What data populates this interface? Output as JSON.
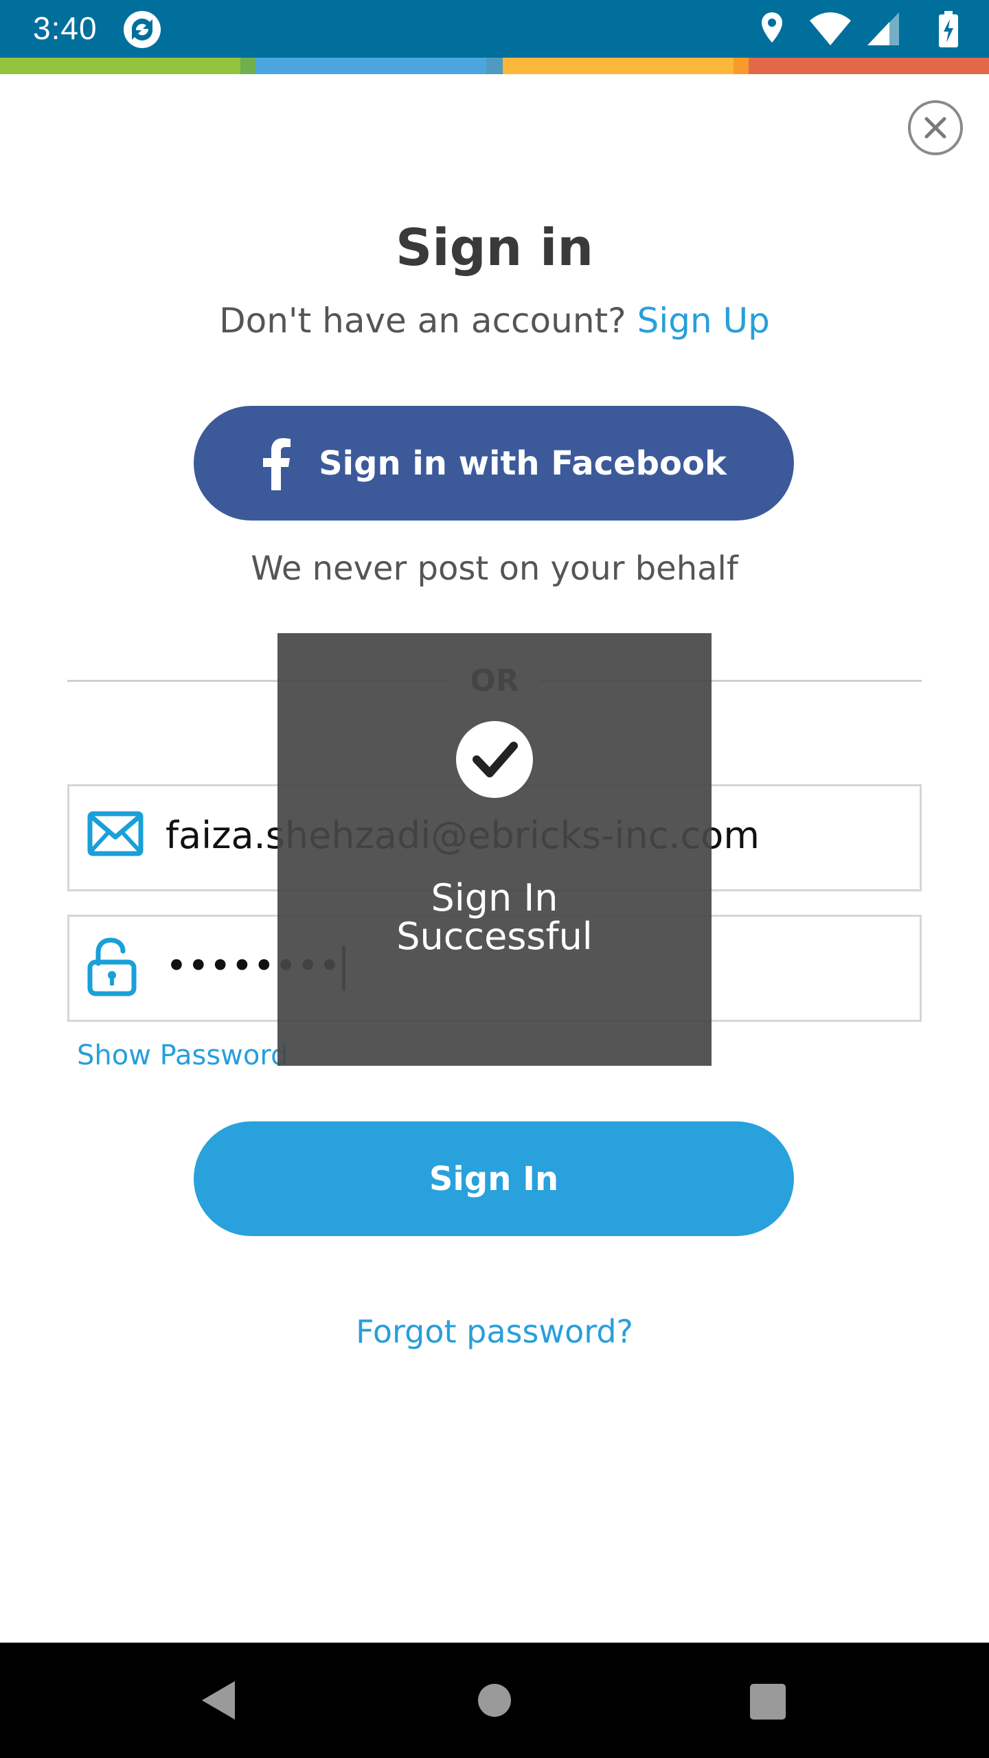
{
  "status_bar": {
    "time": "3:40",
    "icons": [
      "app-sync-icon",
      "location-icon",
      "wifi-icon",
      "cell-signal-icon",
      "battery-charging-icon"
    ]
  },
  "colors": {
    "status_bar": "#006f9c",
    "stripe": [
      "#94c33d",
      "#4ba6df",
      "#fdb73b",
      "#e36846"
    ],
    "facebook": "#3c5a9a",
    "primary": "#28a1dc",
    "link": "#279fda"
  },
  "header": {
    "title": "Sign in",
    "no_account_text": "Don't have an account?",
    "signup_link": "Sign Up"
  },
  "facebook": {
    "button_label": "Sign in with Facebook",
    "note": "We never post on your behalf"
  },
  "divider": {
    "label": "OR"
  },
  "form": {
    "email_value": "faiza.shehzadi@ebricks-inc.com",
    "password_masked": "••••••••",
    "show_password_label": "Show Password",
    "submit_label": "Sign In",
    "forgot_label": "Forgot password?"
  },
  "toast": {
    "line1": "Sign In",
    "line2": "Successful"
  }
}
